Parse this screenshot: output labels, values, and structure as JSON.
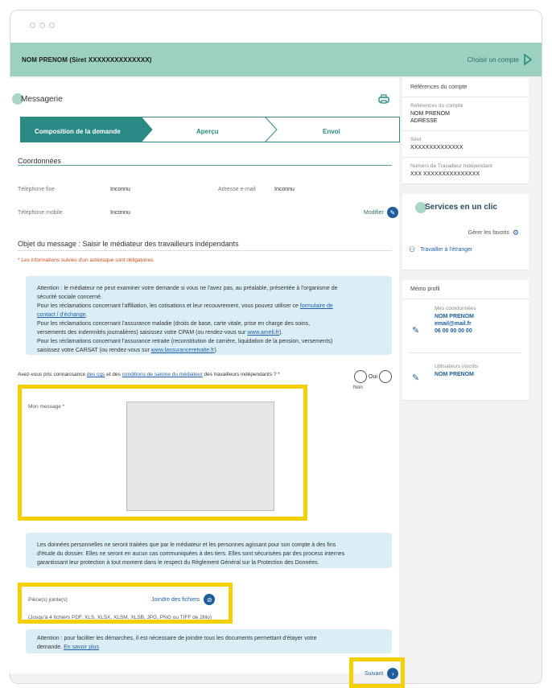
{
  "header": {
    "identity": "NOM PRENOM (Siret XXXXXXXXXXXXXX)",
    "choose_account": "Choisir un compte"
  },
  "messagerie": {
    "title": "Messagerie",
    "steps": [
      {
        "label": "Composition de la demande",
        "active": true
      },
      {
        "label": "Aperçu",
        "active": false
      },
      {
        "label": "Envoi",
        "active": false
      }
    ]
  },
  "coordonnees": {
    "title": "Coordonnées",
    "phone_fixed_label": "Téléphone fixe",
    "phone_fixed_value": "Inconnu",
    "email_label": "Adresse e-mail",
    "email_value": "Inconnu",
    "phone_mobile_label": "Téléphone mobile",
    "phone_mobile_value": "Inconnu",
    "modify": "Modifier"
  },
  "objet": {
    "title": "Objet du message : Saisir le médiateur des travailleurs indépendants",
    "required_note": "* Les informations suivies d'un astérisque sont obligatoires"
  },
  "attention1": {
    "l1": "Attention : le médiateur ne peut examiner votre demande si vous ne l'avez pas, au préalable, présentée à l'organisme de",
    "l2": "sécurité sociale concerné.",
    "l3a": "Pour les réclamations concernant l'affiliation, les cotisations et leur recouvrement, vous pouvez utiliser ce ",
    "l3link": "formulaire de",
    "l4link": "contact / d'échange",
    "l4b": ".",
    "l5": "Pour les réclamations concernant l'assurance maladie (droits de base, carte vitale, prise en charge des soins,",
    "l6a": "versements des indemnités journalières) saisissez votre CPAM (ou rendez-vous sur ",
    "l6link": "www.ameli.fr",
    "l6b": ").",
    "l7": "Pour les réclamations concernant l'assurance retraite (reconstitution de carrière, liquidation de la pension, versements)",
    "l8a": "saisissez votre CARSAT (ou rendez-vous sur ",
    "l8link": "www.lassuranceretraite.fr",
    "l8b": ")."
  },
  "consent": {
    "a": "Avez-vous pris connaissance ",
    "link1": "des cgs",
    "b": " et des ",
    "link2": "conditions de saisine du médiateur",
    "c": " des travailleurs indépendants ? *",
    "oui": "Oui",
    "non": "Non"
  },
  "message": {
    "label": "Mon message *"
  },
  "privacy": {
    "l1": "Les données personnelles ne seront traitées que par le médiateur et les personnes agissant pour son compte à des fins",
    "l2": "d'étude du dossier. Elles ne seront en aucun cas communiquées à des tiers. Elles sont sécurisées par des process internes",
    "l3": "garantissant leur protection à tout moment dans le respect du Règlement Général sur la Protection des Données."
  },
  "attachments": {
    "label": "Pièce(s) jointe(s)",
    "join": "Joindre des fichiers",
    "hint": "(Jusqu'à 4 fichiers PDF, XLS, XLSX, XLSM, XLSB, JPG, PNG ou TIFF de 2Mo)"
  },
  "attention2": {
    "l1": "Attention : pour faciliter les démarches, il est nécessaire de joindre tous les documents permettant d'étayer votre",
    "l2a": "demande. ",
    "l2link": "En savoir plus"
  },
  "footer": {
    "next": "Suivant"
  },
  "account_refs": {
    "header": "Références du compte",
    "refs_label": "Références du compte",
    "name": "NOM PRENOM",
    "address": "ADRESSE",
    "siret_label": "Siret",
    "siret_value": "XXXXXXXXXXXXXX",
    "ti_label": "Numéro de Travailleur Indépendant",
    "ti_value": "XXX XXXXXXXXXXXXXXX"
  },
  "services": {
    "title": "Services en un clic",
    "manage_favorites": "Gérer les favoris",
    "item": "Travailler à l'étranger"
  },
  "memo": {
    "header": "Mémo profil",
    "coords_label": "Mes coordonnées",
    "name": "NOM PRENOM",
    "email": "email@mail.fr",
    "phone": "06 00 00 00 00",
    "users_label": "Utilisateurs inscrits",
    "user": "NOM PRENOM"
  },
  "colors": {
    "accent": "#2a8a84",
    "topbar": "#9cd0c0",
    "info_bg": "#dbeef6",
    "highlight": "#f5d000",
    "link": "#1f5ea8"
  }
}
